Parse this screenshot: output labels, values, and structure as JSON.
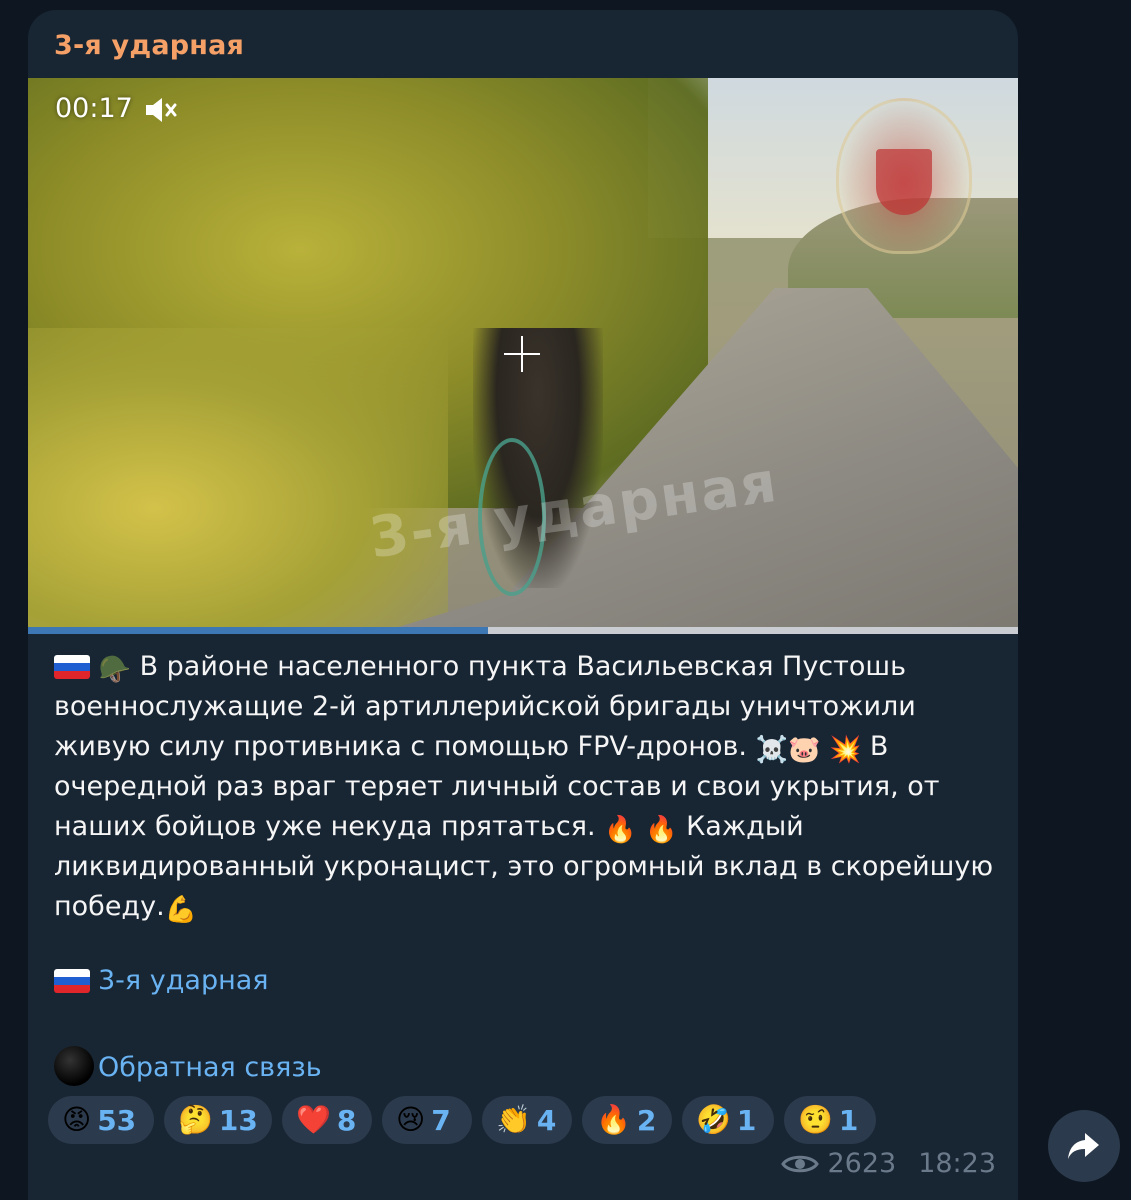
{
  "channel": {
    "title": "3-я ударная"
  },
  "video": {
    "timestamp": "00:17",
    "progress": 0.465,
    "watermark": "3-я ударная"
  },
  "post": {
    "caption_line1": "В районе населенного пункта Васильевская Пустошь военнослужащие 2-й артиллерийской бригады уничтожили живую силу противника с помощью FPV-дронов.",
    "caption_line2": "В очередной раз враг теряет личный состав и свои укрытия, от наших бойцов уже некуда прятаться.",
    "caption_line3": "Каждый ликвидированный укронацист, это огромный вклад в скорейшую победу.",
    "emojis": {
      "helmet": "🪖",
      "skull": "☠️",
      "pig": "🐷",
      "boom": "💥",
      "fire": "🔥",
      "muscle": "💪"
    },
    "signature_link": "3-я ударная",
    "feedback_link": "Обратная связь"
  },
  "reactions": [
    {
      "emoji": "😡",
      "count": "53"
    },
    {
      "emoji": "🤔",
      "count": "13"
    },
    {
      "emoji": "❤️",
      "count": "8"
    },
    {
      "emoji": "😢",
      "count": "7"
    },
    {
      "emoji": "👏",
      "count": "4"
    },
    {
      "emoji": "🔥",
      "count": "2"
    },
    {
      "emoji": "🤣",
      "count": "1"
    },
    {
      "emoji": "🤨",
      "count": "1"
    }
  ],
  "meta": {
    "views": "2623",
    "time": "18:23"
  },
  "colors": {
    "bg": "#0e1621",
    "bubble": "#182533",
    "accent": "#6ab3f3",
    "title": "#f5a067"
  }
}
